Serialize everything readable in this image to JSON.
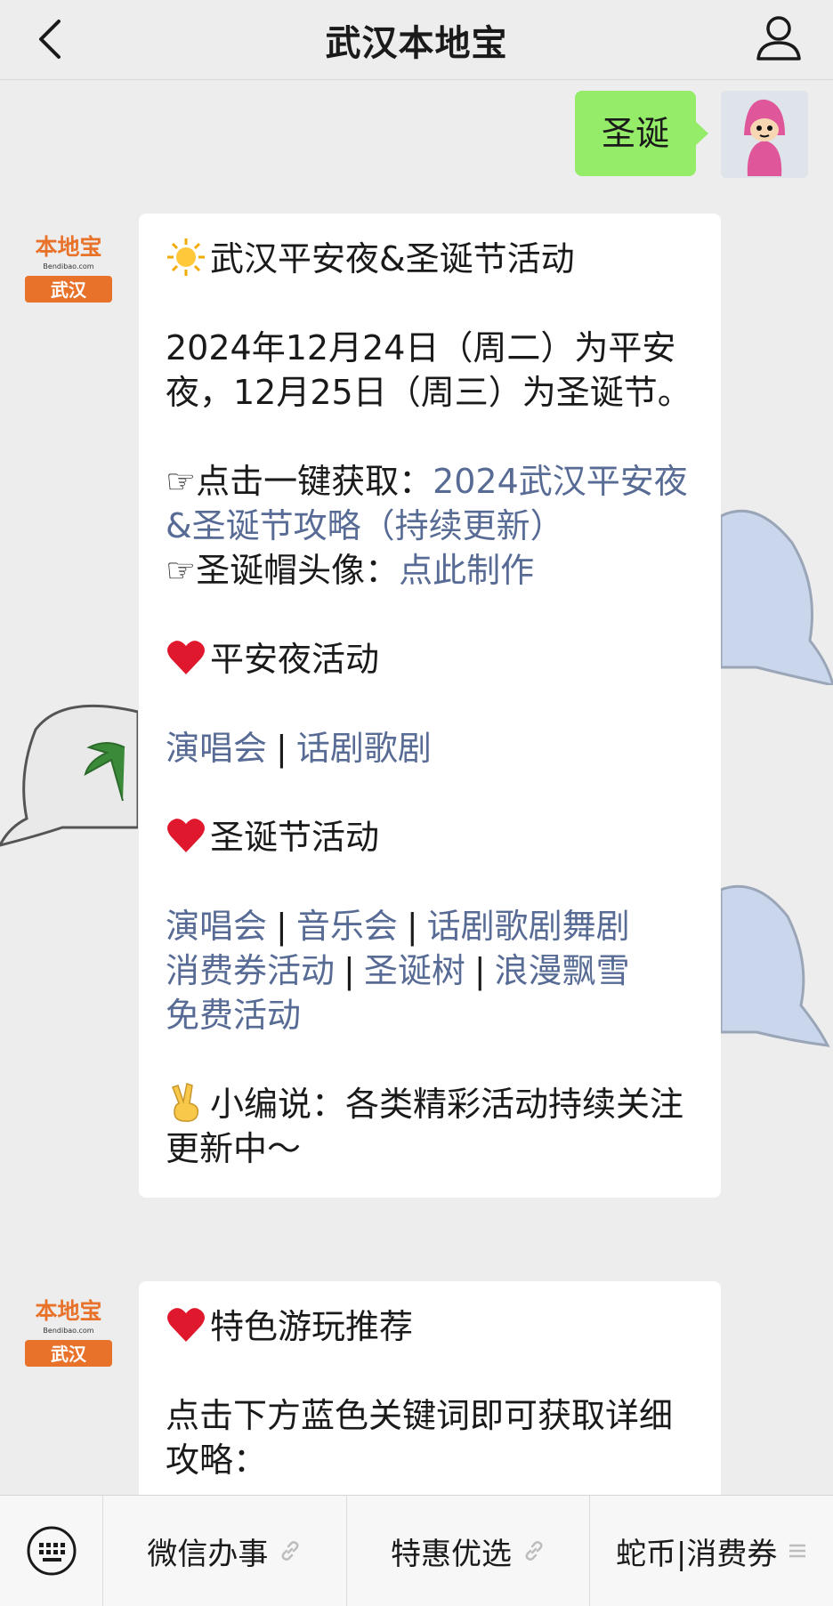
{
  "header": {
    "title": "武汉本地宝"
  },
  "my_message": {
    "text": "圣诞"
  },
  "brand": {
    "logo_text": "本地宝",
    "logo_sub": "Bendibao.com",
    "city": "武汉",
    "color": "#e8722a"
  },
  "message1": {
    "heading": "武汉平安夜&圣诞节活动",
    "intro": "2024年12月24日（周二）为平安夜，12月25日（周三）为圣诞节。",
    "guide_prefix": "☞点击一键获取：",
    "guide_link": "2024武汉平安夜&圣诞节攻略（持续更新）",
    "hat_prefix": "☞圣诞帽头像：",
    "hat_link": "点此制作",
    "eve_heading": "平安夜活动",
    "eve_links": [
      "演唱会",
      "话剧歌剧"
    ],
    "xmas_heading": "圣诞节活动",
    "xmas_links": [
      "演唱会",
      "音乐会",
      "话剧歌剧舞剧",
      "消费券活动",
      "圣诞树",
      "浪漫飘雪",
      "免费活动"
    ],
    "editor_note": "小编说：各类精彩活动持续关注更新中～"
  },
  "message2": {
    "heading": "特色游玩推荐",
    "text": "点击下方蓝色关键词即可获取详细攻略："
  },
  "menu": {
    "items": [
      {
        "label": "微信办事",
        "icon": "link-icon"
      },
      {
        "label": "特惠优选",
        "icon": "link-icon"
      },
      {
        "label": "蛇币|消费券",
        "icon": "menu-lines-icon"
      }
    ]
  },
  "colors": {
    "link": "#576b95",
    "my_bubble": "#95ec69",
    "background": "#ededed"
  }
}
